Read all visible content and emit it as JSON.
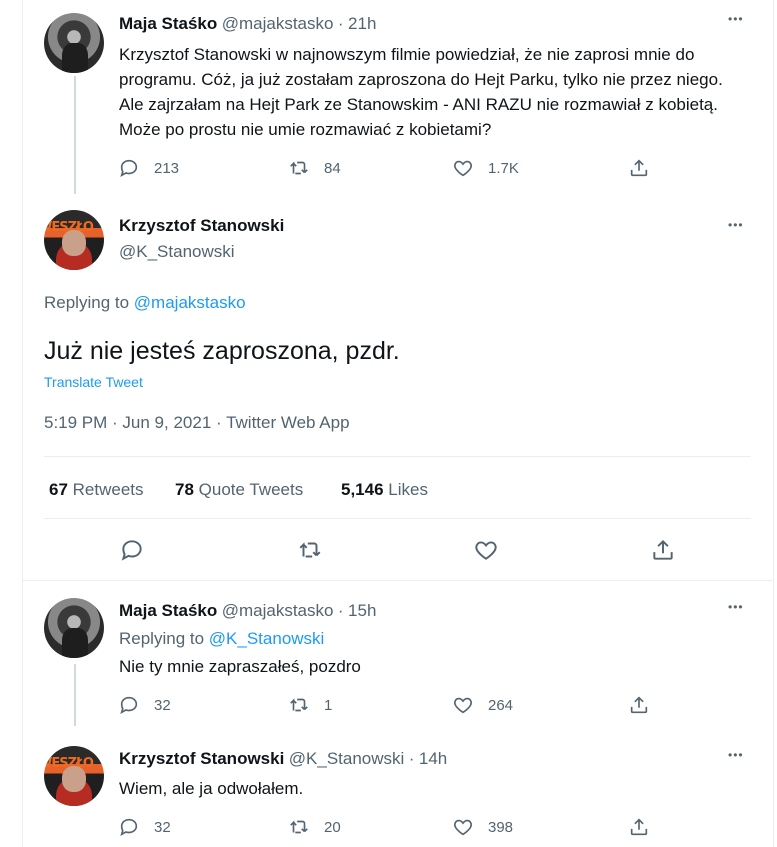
{
  "tweets": {
    "t1": {
      "name": "Maja Staśko",
      "handle": "@majakstasko",
      "time": "21h",
      "text": "Krzysztof Stanowski w najnowszym filmie powiedział, że nie zaprosi mnie do programu. Cóż, ja już zostałam zaproszona do Hejt Parku, tylko nie przez niego. Ale zajrzałam na Hejt Park ze Stanowskim - ANI RAZU nie rozmawiał z kobietą. Może po prostu nie umie rozmawiać z kobietami?",
      "replies": "213",
      "retweets": "84",
      "likes": "1.7K"
    },
    "main": {
      "name": "Krzysztof Stanowski",
      "handle": "@K_Stanowski",
      "replying_label": "Replying to",
      "replying_to": "@majakstasko",
      "text": "Już nie jesteś zaproszona, pzdr.",
      "translate": "Translate Tweet",
      "meta": "5:19 PM · Jun 9, 2021 · Twitter Web App",
      "retweets_count": "67",
      "retweets_label": "Retweets",
      "quotes_count": "78",
      "quotes_label": "Quote Tweets",
      "likes_count": "5,146",
      "likes_label": "Likes"
    },
    "t3": {
      "name": "Maja Staśko",
      "handle": "@majakstasko",
      "time": "15h",
      "replying_label": "Replying to",
      "replying_to": "@K_Stanowski",
      "text": "Nie ty mnie zapraszałeś, pozdro",
      "replies": "32",
      "retweets": "1",
      "likes": "264"
    },
    "t4": {
      "name": "Krzysztof Stanowski",
      "handle": "@K_Stanowski",
      "time": "14h",
      "text": "Wiem, ale ja odwołałem.",
      "replies": "32",
      "retweets": "20",
      "likes": "398"
    }
  },
  "separator": "·",
  "more": "•••",
  "colors": {
    "link": "#1d9bf0",
    "secondary": "#536471",
    "border": "#ebeef0"
  }
}
